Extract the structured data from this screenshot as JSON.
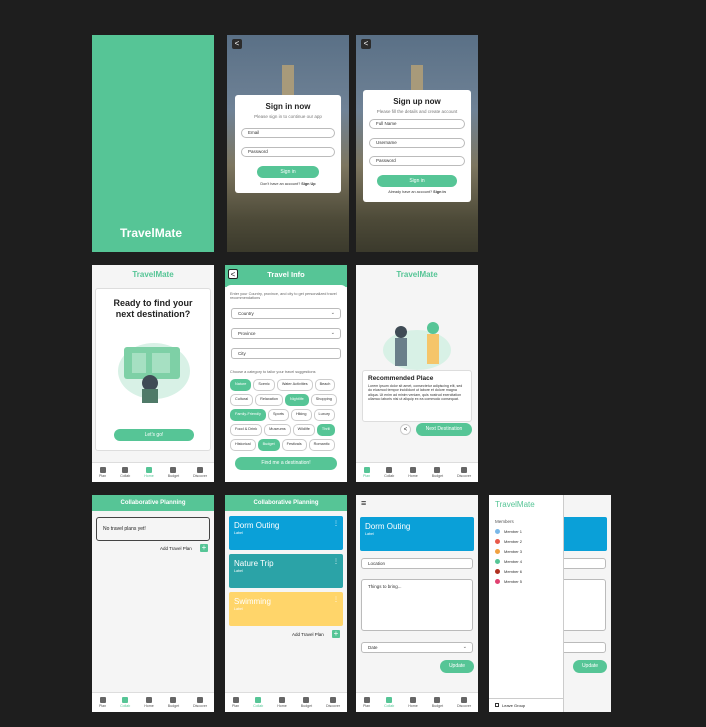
{
  "splash": {
    "title": "TravelMate"
  },
  "signin": {
    "back": "<",
    "title": "Sign in now",
    "subtitle": "Please sign in to continue our app",
    "email": "Email",
    "password": "Password",
    "button": "Sign in",
    "footer_q": "Don't have an account?",
    "footer_link": "Sign Up"
  },
  "signup": {
    "back": "<",
    "title": "Sign up now",
    "subtitle": "Please fill the details and create account",
    "full_name": "Full Name",
    "username": "Username",
    "password": "Password",
    "button": "Sign in",
    "footer_q": "Already have an account?",
    "footer_link": "Sign in"
  },
  "home": {
    "brand": "TravelMate",
    "headline": "Ready to find your next destination?",
    "button": "Let's go!"
  },
  "travel_info": {
    "title": "Travel Info",
    "intro": "Enter your Country, province, and city to get personalized travel recommendations",
    "country": "Country",
    "province": "Province",
    "city": "City",
    "chips_intro": "Choose a category to tailor your travel suggestions",
    "chips": [
      {
        "label": "Nature",
        "on": true
      },
      {
        "label": "Scenic",
        "on": false
      },
      {
        "label": "Water Activities",
        "on": false
      },
      {
        "label": "Beach",
        "on": false
      },
      {
        "label": "Cultural",
        "on": false
      },
      {
        "label": "Relaxation",
        "on": false
      },
      {
        "label": "Nightlife",
        "on": true
      },
      {
        "label": "Shopping",
        "on": false
      },
      {
        "label": "Family-Friendly",
        "on": true
      },
      {
        "label": "Sports",
        "on": false
      },
      {
        "label": "Hiking",
        "on": false
      },
      {
        "label": "Luxury",
        "on": false
      },
      {
        "label": "Food & Drink",
        "on": false
      },
      {
        "label": "Museums",
        "on": false
      },
      {
        "label": "Wildlife",
        "on": false
      },
      {
        "label": "Thrill",
        "on": true
      },
      {
        "label": "Historical",
        "on": false
      },
      {
        "label": "Budget",
        "on": true
      },
      {
        "label": "Festivals",
        "on": false
      },
      {
        "label": "Romantic",
        "on": false
      }
    ],
    "button": "Find me a destination!"
  },
  "recommend": {
    "brand": "TravelMate",
    "title": "Recommended Place",
    "body": "Lorem ipsum dolor sit amet, consectetur adipiscing elit, sed do eiusmod tempor incididunt ut labore et dolore magna aliqua. Ut enim ad minim veniam, quis nostrud exercitation ullamco laboris nisi ut aliquip ex ea commodo consequat.",
    "prev": "<",
    "next": "Next Destination"
  },
  "nav": [
    "Plan",
    "Collab",
    "Home",
    "Budget",
    "Discover"
  ],
  "collab_empty": {
    "header": "Collaborative Planning",
    "empty": "No travel plans yet!",
    "add": "Add Travel Plan",
    "plus": "+"
  },
  "collab_list": {
    "header": "Collaborative Planning",
    "plans": [
      {
        "title": "Dorm Outing",
        "label": "Label",
        "color": "#0aa0d8"
      },
      {
        "title": "Nature Trip",
        "label": "Label",
        "color": "#2ba3a7"
      },
      {
        "title": "Swimming",
        "label": "Label",
        "color": "#ffd56a"
      }
    ],
    "add": "Add Travel Plan",
    "plus": "+",
    "menu": "⋮"
  },
  "plan_detail": {
    "menu": "≡",
    "title": "Dorm Outing",
    "label": "Label",
    "location": "Location",
    "things": "Things to bring...",
    "date": "Date",
    "button": "Update"
  },
  "drawer": {
    "brand": "TravelMate",
    "members_title": "Members",
    "members": [
      {
        "name": "Member 1",
        "color": "#7ab8e8"
      },
      {
        "name": "Member 2",
        "color": "#e8594a"
      },
      {
        "name": "Member 3",
        "color": "#f0a040"
      },
      {
        "name": "Member 4",
        "color": "#56c596"
      },
      {
        "name": "Member 6",
        "color": "#b03020"
      },
      {
        "name": "Member 5",
        "color": "#e04070"
      }
    ],
    "leave": "Leave Group",
    "button": "Update"
  },
  "colors": {
    "accent": "#56c596",
    "bg": "#1e1e1e"
  }
}
